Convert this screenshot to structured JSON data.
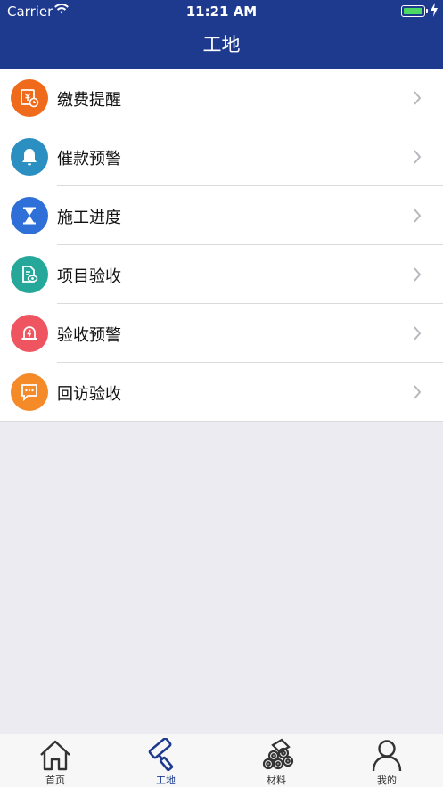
{
  "status_bar": {
    "carrier": "Carrier",
    "time": "11:21 AM"
  },
  "header": {
    "title": "工地"
  },
  "menu": [
    {
      "label": "缴费提醒",
      "icon": "payment-reminder-icon",
      "color": "#f06a1c"
    },
    {
      "label": "催款预警",
      "icon": "bell-icon",
      "color": "#2b8fc2"
    },
    {
      "label": "施工进度",
      "icon": "hourglass-icon",
      "color": "#2e6fd8"
    },
    {
      "label": "项目验收",
      "icon": "document-view-icon",
      "color": "#25a89a"
    },
    {
      "label": "验收预警",
      "icon": "alarm-light-icon",
      "color": "#ef5560"
    },
    {
      "label": "回访验收",
      "icon": "chat-bubble-icon",
      "color": "#f58a28"
    }
  ],
  "tabbar": {
    "items": [
      {
        "label": "首页",
        "icon": "home-icon"
      },
      {
        "label": "工地",
        "icon": "construction-roller-icon",
        "active": true
      },
      {
        "label": "材料",
        "icon": "materials-pipes-icon"
      },
      {
        "label": "我的",
        "icon": "person-icon"
      }
    ],
    "active_color": "#1d3a8f"
  }
}
